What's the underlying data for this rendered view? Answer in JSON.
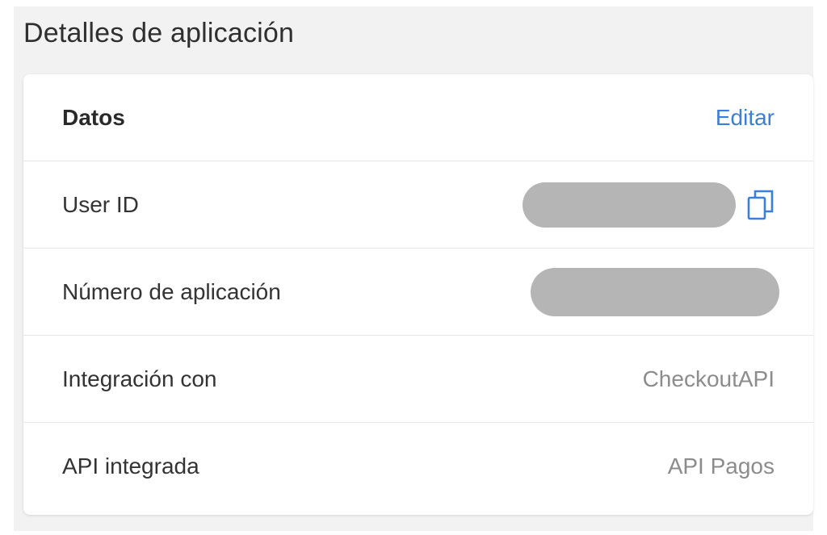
{
  "section": {
    "title": "Detalles de aplicación"
  },
  "card": {
    "header": {
      "label": "Datos",
      "edit_label": "Editar"
    },
    "rows": [
      {
        "label": "User ID",
        "value": "",
        "redacted": true,
        "copy_icon": "copy-icon"
      },
      {
        "label": "Número de aplicación",
        "value": "",
        "redacted": true
      },
      {
        "label": "Integración con",
        "value": "CheckoutAPI"
      },
      {
        "label": "API integrada",
        "value": "API Pagos"
      }
    ]
  },
  "colors": {
    "accent": "#3b7fd6",
    "background": "#f2f2f2",
    "card": "#ffffff",
    "redacted": "#b5b5b5"
  }
}
